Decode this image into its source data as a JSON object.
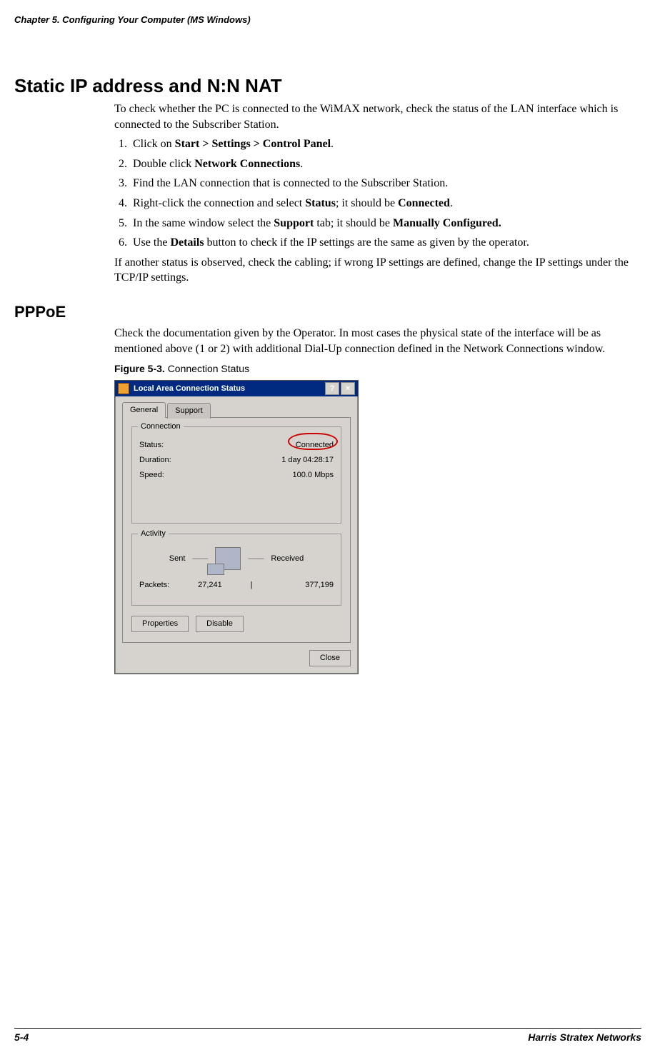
{
  "header": {
    "running": "Chapter 5.  Configuring Your Computer (MS Windows)"
  },
  "sec1": {
    "title": "Static IP address and N:N NAT",
    "intro": "To check whether the PC is connected to the WiMAX network, check the status of the LAN interface which is connected to the Subscriber Station.",
    "steps": {
      "s1a": "Click on ",
      "s1b": "Start > Settings > Control Panel",
      "s1c": ".",
      "s2a": "Double click ",
      "s2b": "Network Connections",
      "s2c": ".",
      "s3": "Find the LAN connection that is connected to the Subscriber Station.",
      "s4a": "Right-click the connection and select ",
      "s4b": "Status",
      "s4c": "; it should be ",
      "s4d": "Connected",
      "s4e": ".",
      "s5a": "In the same window select the ",
      "s5b": "Support",
      "s5c": " tab; it should be ",
      "s5d": "Manually Configured.",
      "s6a": "Use the ",
      "s6b": "Details",
      "s6c": " button to check if the IP settings are the same as given by the operator."
    },
    "after": "If another status is observed, check the cabling; if wrong IP settings are defined, change the IP settings under the TCP/IP settings."
  },
  "sec2": {
    "title": "PPPoE",
    "p": "Check the documentation given by the Operator. In most cases the physical state of the interface will be as mentioned above (1 or 2) with additional Dial-Up connection defined in the Network Connections window.",
    "figlabel": "Figure 5-3. ",
    "figtitle": "Connection Status"
  },
  "dialog": {
    "title": "Local Area Connection Status",
    "help_glyph": "?",
    "close_glyph": "×",
    "tab_general": "General",
    "tab_support": "Support",
    "grp_connection": "Connection",
    "lbl_status": "Status:",
    "val_status": "Connected",
    "lbl_duration": "Duration:",
    "val_duration": "1 day 04:28:17",
    "lbl_speed": "Speed:",
    "val_speed": "100.0 Mbps",
    "grp_activity": "Activity",
    "lbl_sent": "Sent",
    "lbl_received": "Received",
    "lbl_packets": "Packets:",
    "val_sent": "27,241",
    "bar": "|",
    "val_recv": "377,199",
    "btn_properties": "Properties",
    "btn_disable": "Disable",
    "btn_close": "Close"
  },
  "footer": {
    "left": "5-4",
    "right": "Harris Stratex Networks"
  }
}
